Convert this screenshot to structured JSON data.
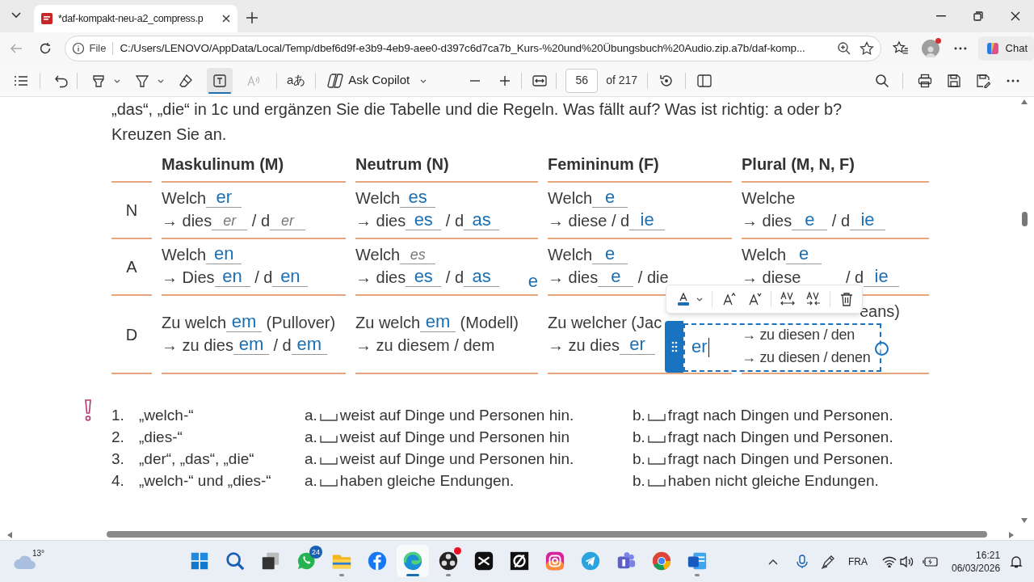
{
  "browser": {
    "tab_title": "*daf-kompakt-neu-a2_compress.p",
    "address_scheme": "File",
    "address": "C:/Users/LENOVO/AppData/Local/Temp/dbef6d9f-e3b9-4eb9-aee0-d397c6d7ca7b_Kurs-%20und%20Übungsbuch%20Audio.zip.a7b/daf-komp...",
    "chat_label": "Chat"
  },
  "pdf_toolbar": {
    "tools": [
      {
        "kind": "highlight",
        "selected": false,
        "disabled": false
      },
      {
        "kind": "draw",
        "selected": false,
        "disabled": false
      },
      {
        "kind": "erase",
        "selected": false,
        "disabled": false
      },
      {
        "kind": "text",
        "selected": true,
        "disabled": false
      },
      {
        "kind": "read_aloud",
        "selected": false,
        "disabled": true
      }
    ],
    "translate_label": "aあ",
    "copilot_label": "Ask Copilot",
    "page": "56",
    "page_total": "of 217"
  },
  "document": {
    "intro": [
      "„das“, „die“ in 1c und ergänzen Sie die Tabelle und die Regeln. Was fällt auf? Was ist richtig: a oder b?",
      "Kreuzen Sie an."
    ],
    "table": {
      "columns": [
        "Maskulinum (M)",
        "Neutrum (N)",
        "Femininum (F)",
        "Plural (M, N, F)"
      ],
      "rows": [
        {
          "case": "N",
          "cells": [
            [
              [
                {
                  "kind": "text",
                  "text": "Welch"
                },
                {
                  "kind": "fill",
                  "text": "er"
                }
              ],
              [
                {
                  "kind": "text",
                  "text": "→ dies"
                },
                {
                  "kind": "pencil",
                  "text": "er"
                },
                {
                  "kind": "text",
                  "text": " / d"
                },
                {
                  "kind": "pencil",
                  "text": "er"
                }
              ]
            ],
            [
              [
                {
                  "kind": "text",
                  "text": "Welch"
                },
                {
                  "kind": "fill",
                  "text": "es"
                }
              ],
              [
                {
                  "kind": "text",
                  "text": "→ dies"
                },
                {
                  "kind": "fill",
                  "text": "es"
                },
                {
                  "kind": "text",
                  "text": " / d"
                },
                {
                  "kind": "fill",
                  "text": "as"
                }
              ]
            ],
            [
              [
                {
                  "kind": "text",
                  "text": "Welch"
                },
                {
                  "kind": "fill",
                  "text": "e"
                }
              ],
              [
                {
                  "kind": "text",
                  "text": "→ diese / d"
                },
                {
                  "kind": "fill",
                  "text": "ie"
                }
              ]
            ],
            [
              [
                {
                  "kind": "text",
                  "text": "Welche"
                }
              ],
              [
                {
                  "kind": "text",
                  "text": "→ dies"
                },
                {
                  "kind": "fill",
                  "text": "e"
                },
                {
                  "kind": "text",
                  "text": " / d"
                },
                {
                  "kind": "fill",
                  "text": "ie"
                }
              ]
            ]
          ]
        },
        {
          "case": "A",
          "cells": [
            [
              [
                {
                  "kind": "text",
                  "text": "Welch"
                },
                {
                  "kind": "fill",
                  "text": "en"
                }
              ],
              [
                {
                  "kind": "text",
                  "text": "→ Dies"
                },
                {
                  "kind": "fill",
                  "text": "en"
                },
                {
                  "kind": "text",
                  "text": " / d"
                },
                {
                  "kind": "fill",
                  "text": "en"
                }
              ]
            ],
            [
              [
                {
                  "kind": "text",
                  "text": "Welch"
                },
                {
                  "kind": "pencil",
                  "text": "es"
                }
              ],
              [
                {
                  "kind": "text",
                  "text": "→ dies"
                },
                {
                  "kind": "fill",
                  "text": "es"
                },
                {
                  "kind": "text",
                  "text": " / d"
                },
                {
                  "kind": "fill",
                  "text": "as"
                },
                {
                  "kind": "note",
                  "text": "e"
                }
              ]
            ],
            [
              [
                {
                  "kind": "text",
                  "text": "Welch"
                },
                {
                  "kind": "fill",
                  "text": "e"
                }
              ],
              [
                {
                  "kind": "text",
                  "text": "→ dies"
                },
                {
                  "kind": "fill",
                  "text": "e"
                },
                {
                  "kind": "text",
                  "text": " / die"
                }
              ]
            ],
            [
              [
                {
                  "kind": "text",
                  "text": "Welch"
                },
                {
                  "kind": "fill",
                  "text": "e"
                }
              ],
              [
                {
                  "kind": "text",
                  "text": "→ diese          / d"
                },
                {
                  "kind": "fill",
                  "text": "ie"
                }
              ]
            ]
          ]
        },
        {
          "case": "D",
          "cells": [
            [
              [
                {
                  "kind": "text",
                  "text": "Zu welch"
                },
                {
                  "kind": "fill",
                  "text": "em"
                },
                {
                  "kind": "text",
                  "text": " (Pullover)"
                }
              ],
              [
                {
                  "kind": "text",
                  "text": "→ zu dies"
                },
                {
                  "kind": "fill",
                  "text": "em"
                },
                {
                  "kind": "text",
                  "text": " / d"
                },
                {
                  "kind": "fill",
                  "text": "em"
                }
              ]
            ],
            [
              [
                {
                  "kind": "text",
                  "text": "Zu welch"
                },
                {
                  "kind": "fill",
                  "text": "em"
                },
                {
                  "kind": "text",
                  "text": " (Modell)"
                }
              ],
              [
                {
                  "kind": "text",
                  "text": "→ zu diesem / dem"
                }
              ]
            ],
            [
              [
                {
                  "kind": "text",
                  "text": "Zu welcher (Jac"
                }
              ],
              [
                {
                  "kind": "text",
                  "text": "→ zu dies"
                },
                {
                  "kind": "fill",
                  "text": "er"
                }
              ]
            ],
            [
              [
                {
                  "kind": "tail",
                  "text": "eans)"
                }
              ],
              [
                {
                  "kind": "small",
                  "text": "→ zu diesen / den"
                }
              ],
              [
                {
                  "kind": "small",
                  "text": "→ zu diesen / denen"
                }
              ]
            ]
          ]
        }
      ]
    },
    "rules": [
      {
        "number": "1.",
        "term": "„welch-“",
        "options": [
          {
            "label": "a.",
            "text": "weist auf Dinge und Personen hin.",
            "checked": false
          },
          {
            "label": "b.",
            "text": "fragt nach Dingen und Personen.",
            "checked": false
          }
        ]
      },
      {
        "number": "2.",
        "term": "„dies-“",
        "options": [
          {
            "label": "a.",
            "text": "weist auf Dinge und Personen hin",
            "checked": false
          },
          {
            "label": "b.",
            "text": "fragt nach Dingen und Personen.",
            "checked": false
          }
        ]
      },
      {
        "number": "3.",
        "term": "„der“, „das“, „die“",
        "options": [
          {
            "label": "a.",
            "text": "weist auf Dinge und Personen hin.",
            "checked": false
          },
          {
            "label": "b.",
            "text": "fragt nach Dingen und Personen.",
            "checked": false
          }
        ]
      },
      {
        "number": "4.",
        "term": "„welch-“ und „dies-“",
        "options": [
          {
            "label": "a.",
            "text": "haben gleiche Endungen.",
            "checked": false
          },
          {
            "label": "b.",
            "text": "haben nicht gleiche Endungen.",
            "checked": false
          }
        ]
      }
    ]
  },
  "text_box": {
    "value": "er"
  },
  "taskbar": {
    "temperature": "13°",
    "apps": [
      {
        "kind": "windows",
        "selected": false,
        "running": false,
        "alert": false
      },
      {
        "kind": "search",
        "selected": false,
        "running": false,
        "alert": false
      },
      {
        "kind": "taskview",
        "selected": false,
        "running": false,
        "alert": false
      },
      {
        "kind": "chat",
        "selected": false,
        "running": false,
        "alert": false,
        "badge": "24"
      },
      {
        "kind": "folder",
        "selected": false,
        "running": true,
        "alert": false
      },
      {
        "kind": "social",
        "selected": false,
        "running": false,
        "alert": false
      },
      {
        "kind": "browser",
        "selected": true,
        "running": true,
        "alert": false
      },
      {
        "kind": "recorder",
        "selected": false,
        "running": true,
        "alert": true
      },
      {
        "kind": "editor",
        "selected": false,
        "running": false,
        "alert": false
      },
      {
        "kind": "knot",
        "selected": false,
        "running": false,
        "alert": false
      },
      {
        "kind": "camera",
        "selected": false,
        "running": false,
        "alert": false
      },
      {
        "kind": "plane",
        "selected": false,
        "running": false,
        "alert": false
      },
      {
        "kind": "people",
        "selected": false,
        "running": false,
        "alert": false
      },
      {
        "kind": "wheel",
        "selected": false,
        "running": false,
        "alert": false
      },
      {
        "kind": "document",
        "selected": false,
        "running": true,
        "alert": false
      }
    ],
    "language": "FRA",
    "time": "16:21",
    "date": "06/03/2026"
  }
}
